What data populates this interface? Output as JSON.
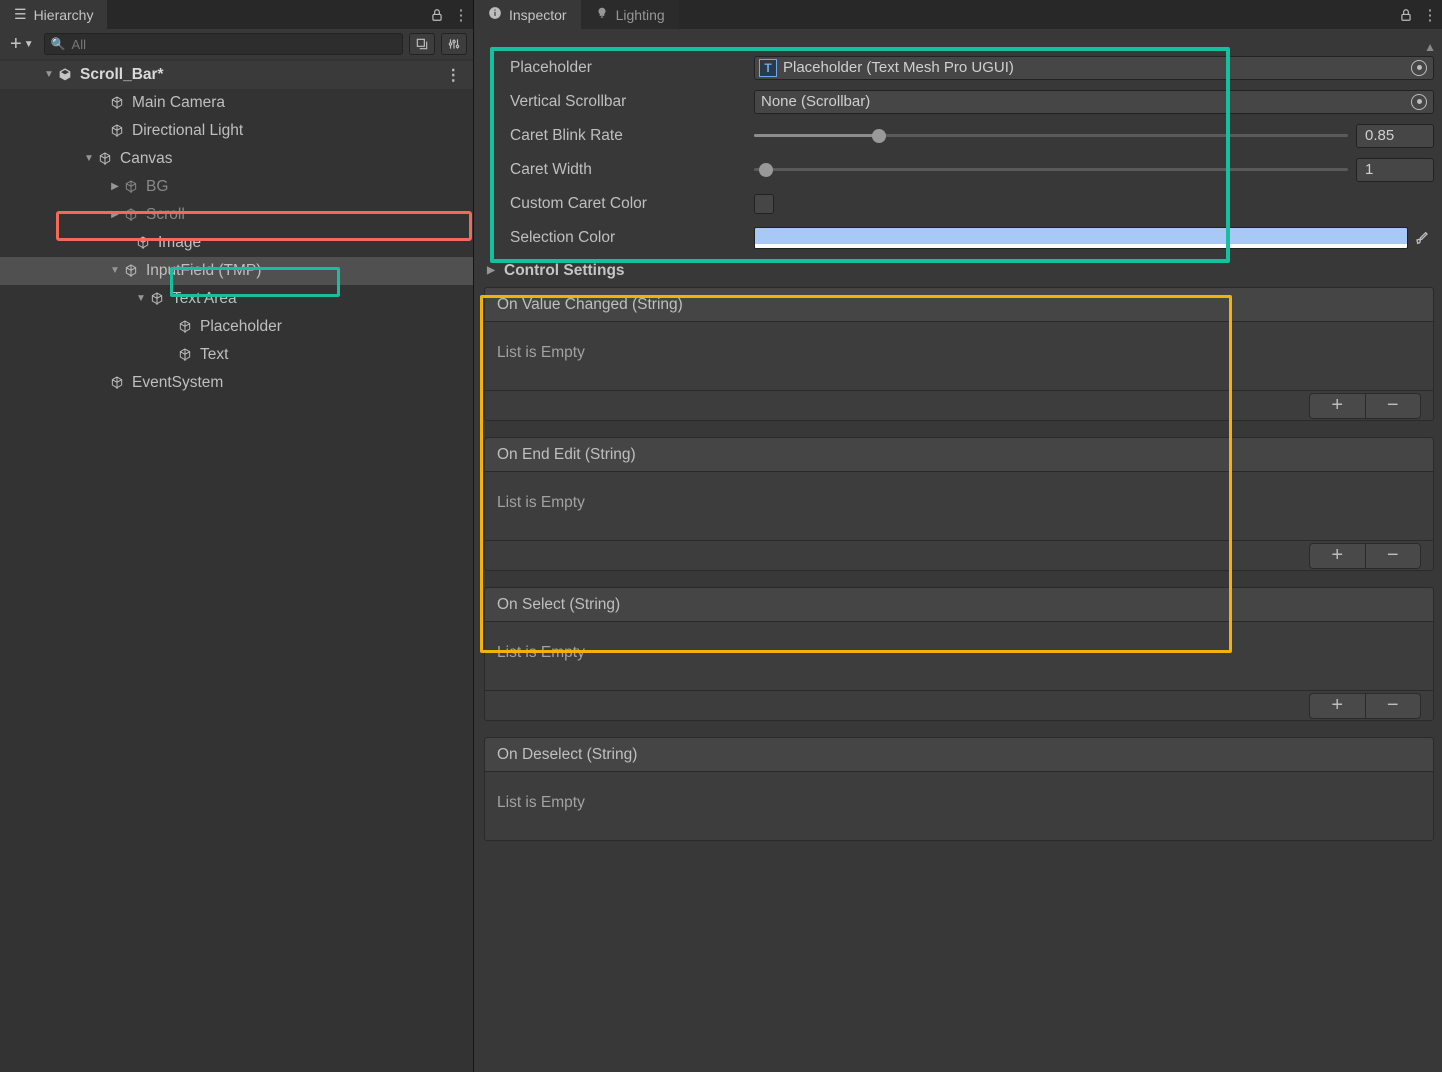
{
  "hierarchy": {
    "tab_label": "Hierarchy",
    "search_placeholder": "All",
    "scene": "Scroll_Bar*",
    "items": {
      "main_camera": "Main Camera",
      "directional_light": "Directional Light",
      "canvas": "Canvas",
      "bg": "BG",
      "scroll": "Scroll",
      "image": "Image",
      "input_field": "InputField (TMP)",
      "text_area": "Text Area",
      "placeholder": "Placeholder",
      "text": "Text",
      "event_system": "EventSystem"
    }
  },
  "inspector": {
    "tab_label": "Inspector",
    "lighting_tab": "Lighting",
    "props": {
      "placeholder_label": "Placeholder",
      "placeholder_value": "Placeholder (Text Mesh Pro UGUI)",
      "vscroll_label": "Vertical Scrollbar",
      "vscroll_value": "None (Scrollbar)",
      "caret_blink_label": "Caret Blink Rate",
      "caret_blink_value": "0.85",
      "caret_width_label": "Caret Width",
      "caret_width_value": "1",
      "custom_color_label": "Custom Caret Color",
      "selection_color_label": "Selection Color"
    },
    "control_settings": "Control Settings",
    "events": {
      "on_value_changed": "On Value Changed (String)",
      "on_end_edit": "On End Edit (String)",
      "on_select": "On Select (String)",
      "on_deselect": "On Deselect (String)",
      "empty": "List is Empty"
    }
  }
}
